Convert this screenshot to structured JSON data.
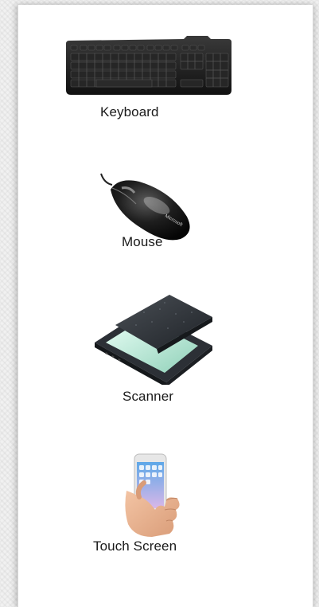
{
  "devices": [
    {
      "icon": "keyboard-icon",
      "label": "Keyboard"
    },
    {
      "icon": "mouse-icon",
      "label": "Mouse"
    },
    {
      "icon": "scanner-icon",
      "label": "Scanner"
    },
    {
      "icon": "touch-screen-icon",
      "label": "Touch Screen"
    }
  ]
}
